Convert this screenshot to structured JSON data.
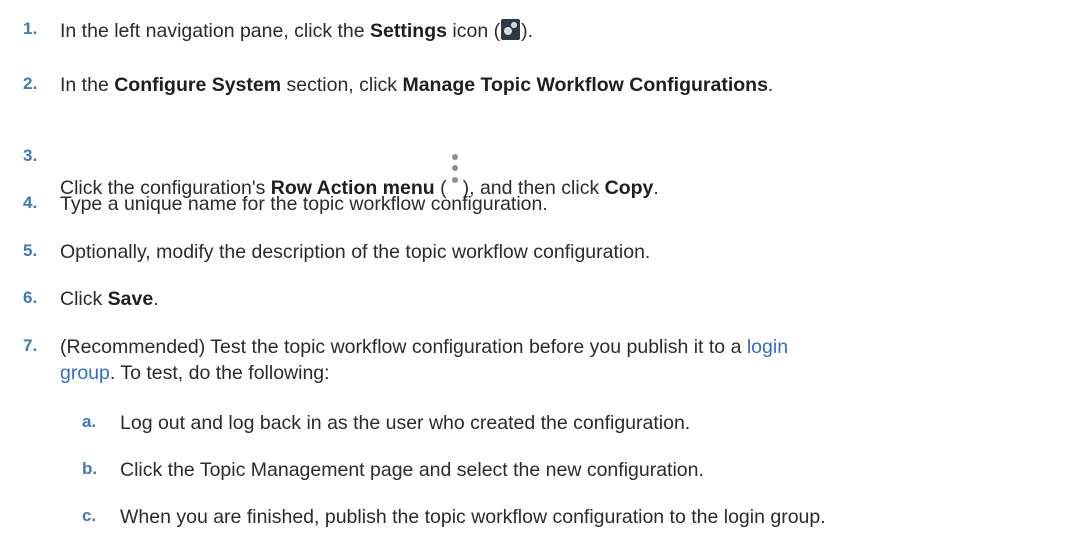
{
  "steps": [
    {
      "num": "1.",
      "parts": {
        "a": "In the left navigation pane, click the ",
        "b": "Settings",
        "c": " icon (",
        "d": ")."
      }
    },
    {
      "num": "2.",
      "parts": {
        "a": "In the ",
        "b": "Configure System",
        "c": " section, click ",
        "d": "Manage Topic Workflow Configurations",
        "e": "."
      }
    },
    {
      "num": "3.",
      "parts": {
        "a": "Click the configuration's ",
        "b": "Row Action menu",
        "c": " (",
        "d": "), and then click ",
        "e": "Copy",
        "f": "."
      }
    },
    {
      "num": "4.",
      "text": "Type a unique name for the topic workflow configuration."
    },
    {
      "num": "5.",
      "text": "Optionally, modify the description of the topic workflow configuration."
    },
    {
      "num": "6.",
      "parts": {
        "a": "Click ",
        "b": "Save",
        "c": "."
      }
    },
    {
      "num": "7.",
      "line1": {
        "a": "(Recommended) Test the topic workflow configuration before you publish it to a ",
        "link": "login"
      },
      "line2": {
        "link": "group",
        "a": ". To test, do the following:"
      }
    }
  ],
  "substeps": [
    {
      "num": "a.",
      "text": "Log out and log back in as the user who created the configuration."
    },
    {
      "num": "b.",
      "text": "Click the Topic Management page and select the new configuration."
    },
    {
      "num": "c.",
      "text": "When you are finished, publish the topic workflow configuration to the login group."
    }
  ],
  "icons": {
    "settings": "settings-gear-icon",
    "row_action": "kebab-menu-icon"
  }
}
